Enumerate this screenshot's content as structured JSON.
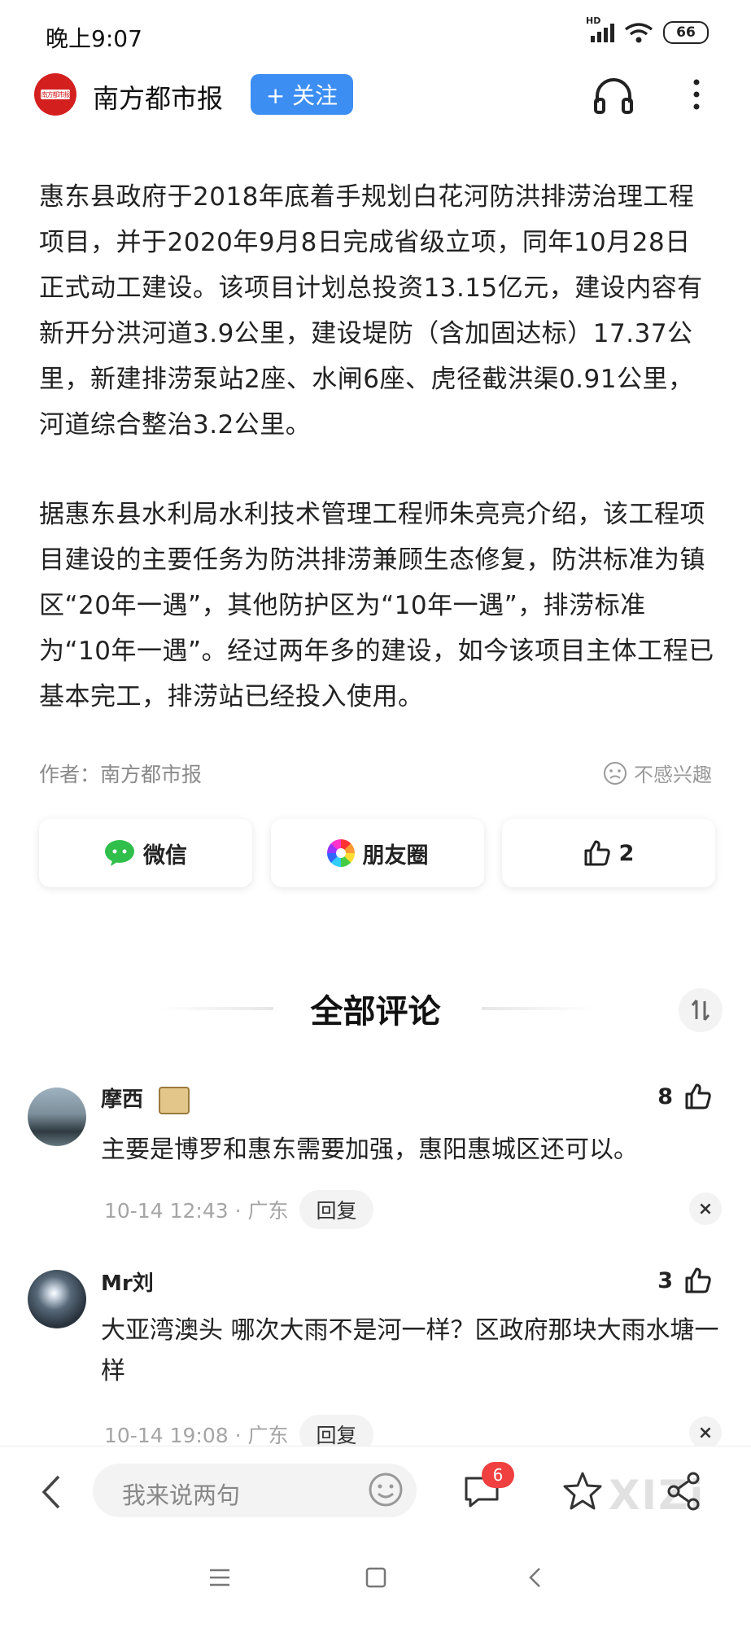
{
  "status_bar": {
    "time": "晚上9:07",
    "network": "HD",
    "battery": "66"
  },
  "header": {
    "source_name": "南方都市报",
    "follow_label": "+ 关注",
    "logo_text": "南方都市报"
  },
  "article": {
    "paragraphs": [
      "惠东县政府于2018年底着手规划白花河防洪排涝治理工程项目，并于2020年9月8日完成省级立项，同年10月28日正式动工建设。该项目计划总投资13.15亿元，建设内容有新开分洪河道3.9公里，建设堤防（含加固达标）17.37公里，新建排涝泵站2座、水闸6座、虎径截洪渠0.91公里，河道综合整治3.2公里。",
      "据惠东县水利局水利技术管理工程师朱亮亮介绍，该工程项目建设的主要任务为防洪排涝兼顾生态修复，防洪标准为镇区“20年一遇”，其他防护区为“10年一遇”，排涝标准为“10年一遇”。经过两年多的建设，如今该项目主体工程已基本完工，排涝站已经投入使用。"
    ],
    "author": "作者：南方都市报",
    "not_interested": "不感兴趣"
  },
  "share": {
    "wechat": "微信",
    "moments": "朋友圈",
    "like_count": "2"
  },
  "comments_section": {
    "title": "全部评论",
    "comments": [
      {
        "user": "摩西",
        "likes": "8",
        "text": "主要是博罗和惠东需要加强，惠阳惠城区还可以。",
        "time": "10-14 12:43 · 广东",
        "reply": "回复",
        "close": "×"
      },
      {
        "user": "Mr刘",
        "likes": "3",
        "text": "大亚湾澳头 哪次大雨不是河一样？区政府那块大雨水塘一样",
        "time": "10-14 19:08 · 广东",
        "reply": "回复",
        "close": "×"
      }
    ]
  },
  "bottom_bar": {
    "input_placeholder": "我来说两句",
    "comment_count": "6",
    "watermark": "XIZi"
  },
  "colors": {
    "accent": "#3d8ef3",
    "badge": "#f04040",
    "wechat_green": "#2fbf4a"
  }
}
